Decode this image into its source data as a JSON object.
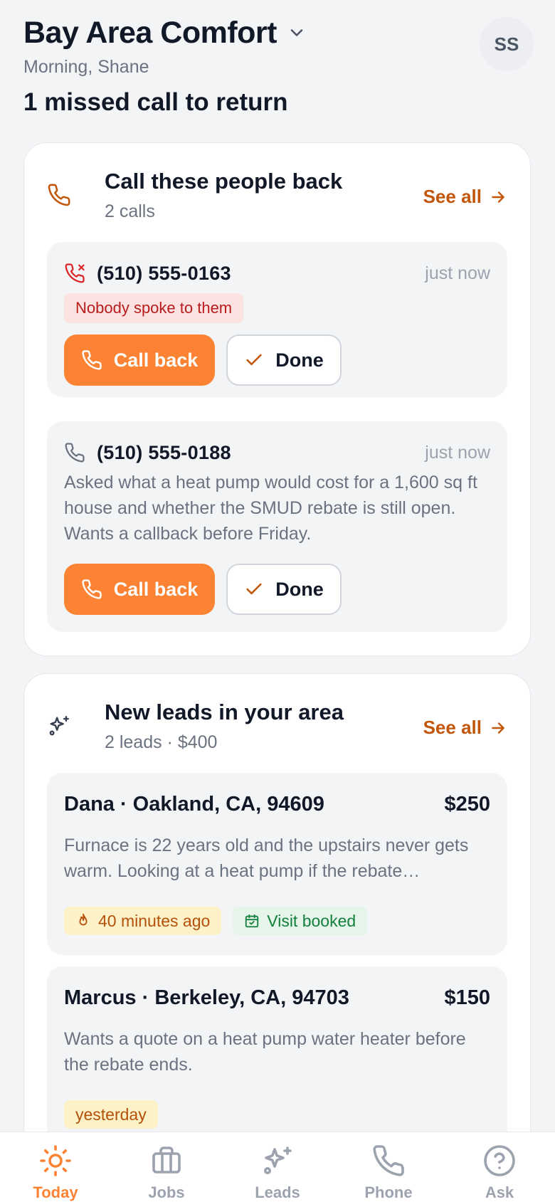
{
  "header": {
    "business_name": "Bay Area Comfort",
    "greeting": "Morning, Shane",
    "avatar_initials": "SS"
  },
  "headline": "1 missed call to return",
  "callbacks": {
    "title": "Call these people back",
    "subtitle": "2 calls",
    "see_all": "See all",
    "icon": "phone-icon",
    "items": [
      {
        "phone": "(510) 555-0163",
        "time": "just now",
        "icon": "phone-missed-icon",
        "tag": "Nobody spoke to them",
        "call_label": "Call back",
        "done_label": "Done"
      },
      {
        "phone": "(510) 555-0188",
        "time": "just now",
        "icon": "phone-icon",
        "description": "Asked what a heat pump would cost for a 1,600 sq ft house and whether the SMUD rebate is still open. Wants a callback before Friday.",
        "call_label": "Call back",
        "done_label": "Done"
      }
    ]
  },
  "leads": {
    "title": "New leads in your area",
    "subtitle": "2 leads · $400",
    "see_all": "See all",
    "icon": "sparkles-icon",
    "items": [
      {
        "name": "Dana · Oakland, CA, 94609",
        "price": "$250",
        "description": "Furnace is 22 years old and the upstairs never gets warm. Looking at a heat pump if the rebate…",
        "time_chip": "40 minutes ago",
        "status_chip": "Visit booked"
      },
      {
        "name": "Marcus · Berkeley, CA, 94703",
        "price": "$150",
        "description": "Wants a quote on a heat pump water heater before the rebate ends.",
        "time_chip": "yesterday"
      }
    ]
  },
  "tabs": [
    {
      "label": "Today",
      "icon": "sun-icon",
      "active": true
    },
    {
      "label": "Jobs",
      "icon": "briefcase-icon",
      "active": false
    },
    {
      "label": "Leads",
      "icon": "sparkles-icon",
      "active": false
    },
    {
      "label": "Phone",
      "icon": "phone-icon",
      "active": false
    },
    {
      "label": "Ask",
      "icon": "help-circle-icon",
      "active": false
    }
  ],
  "colors": {
    "accent": "#fb8333",
    "accent_text": "#c2570c",
    "missed_tag_bg": "#fde2e2",
    "missed_tag_text": "#b91c1c",
    "chip_time_bg": "#fdf1c7",
    "chip_visit_bg": "#e6f5ea",
    "chip_visit_text": "#15803d",
    "background": "#f3f4f6"
  }
}
